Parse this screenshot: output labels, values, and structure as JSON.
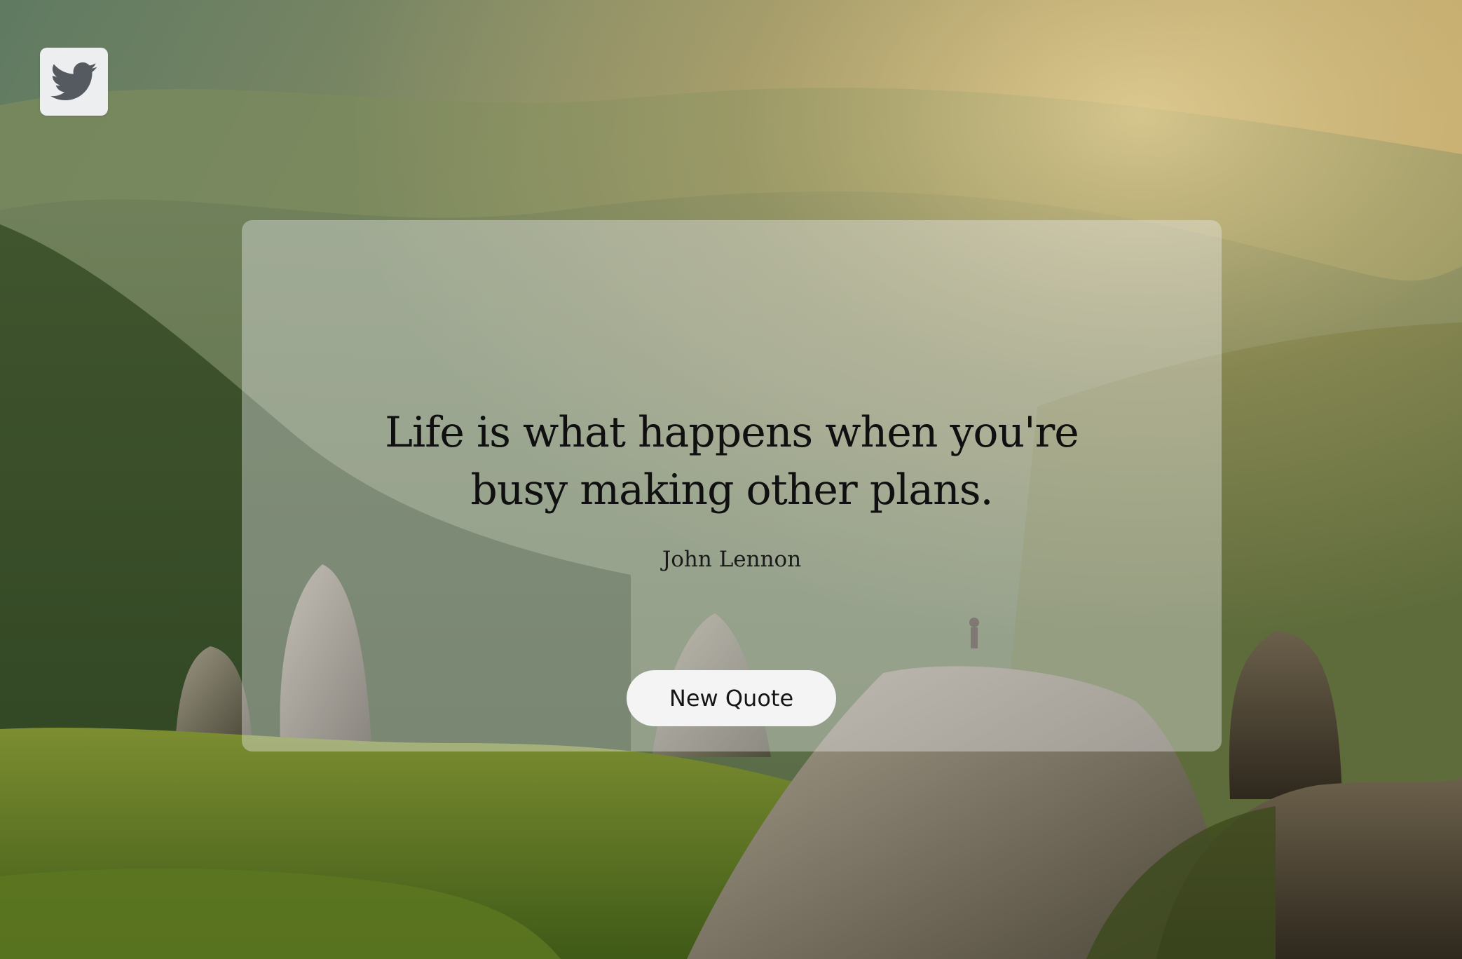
{
  "quote": {
    "text": "Life is what happens when you're busy making other plans.",
    "author": "John Lennon"
  },
  "actions": {
    "new_quote_label": "New Quote",
    "tweet_icon": "twitter-bird-icon"
  },
  "colors": {
    "card_overlay": "#eef0f4",
    "button_bg": "#f4f4f4",
    "text": "#101010"
  }
}
